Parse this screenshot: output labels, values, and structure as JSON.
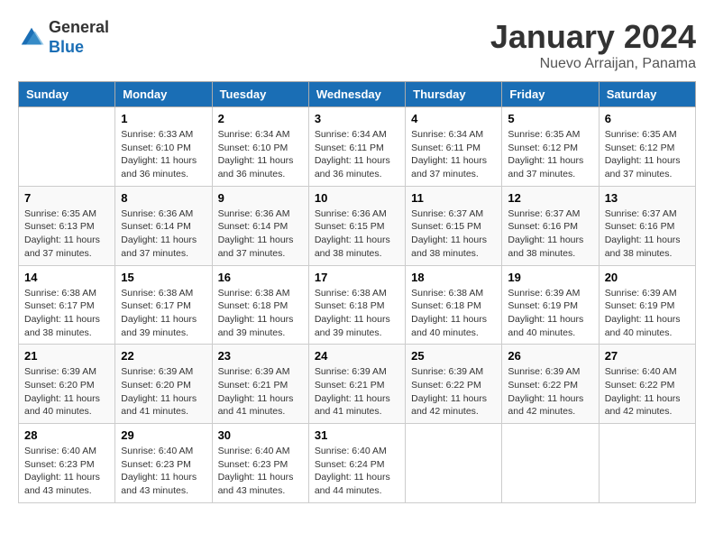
{
  "header": {
    "logo_general": "General",
    "logo_blue": "Blue",
    "month_title": "January 2024",
    "location": "Nuevo Arraijan, Panama"
  },
  "days_of_week": [
    "Sunday",
    "Monday",
    "Tuesday",
    "Wednesday",
    "Thursday",
    "Friday",
    "Saturday"
  ],
  "weeks": [
    [
      {
        "day": "",
        "sunrise": "",
        "sunset": "",
        "daylight": ""
      },
      {
        "day": "1",
        "sunrise": "Sunrise: 6:33 AM",
        "sunset": "Sunset: 6:10 PM",
        "daylight": "Daylight: 11 hours and 36 minutes."
      },
      {
        "day": "2",
        "sunrise": "Sunrise: 6:34 AM",
        "sunset": "Sunset: 6:10 PM",
        "daylight": "Daylight: 11 hours and 36 minutes."
      },
      {
        "day": "3",
        "sunrise": "Sunrise: 6:34 AM",
        "sunset": "Sunset: 6:11 PM",
        "daylight": "Daylight: 11 hours and 36 minutes."
      },
      {
        "day": "4",
        "sunrise": "Sunrise: 6:34 AM",
        "sunset": "Sunset: 6:11 PM",
        "daylight": "Daylight: 11 hours and 37 minutes."
      },
      {
        "day": "5",
        "sunrise": "Sunrise: 6:35 AM",
        "sunset": "Sunset: 6:12 PM",
        "daylight": "Daylight: 11 hours and 37 minutes."
      },
      {
        "day": "6",
        "sunrise": "Sunrise: 6:35 AM",
        "sunset": "Sunset: 6:12 PM",
        "daylight": "Daylight: 11 hours and 37 minutes."
      }
    ],
    [
      {
        "day": "7",
        "sunrise": "Sunrise: 6:35 AM",
        "sunset": "Sunset: 6:13 PM",
        "daylight": "Daylight: 11 hours and 37 minutes."
      },
      {
        "day": "8",
        "sunrise": "Sunrise: 6:36 AM",
        "sunset": "Sunset: 6:14 PM",
        "daylight": "Daylight: 11 hours and 37 minutes."
      },
      {
        "day": "9",
        "sunrise": "Sunrise: 6:36 AM",
        "sunset": "Sunset: 6:14 PM",
        "daylight": "Daylight: 11 hours and 37 minutes."
      },
      {
        "day": "10",
        "sunrise": "Sunrise: 6:36 AM",
        "sunset": "Sunset: 6:15 PM",
        "daylight": "Daylight: 11 hours and 38 minutes."
      },
      {
        "day": "11",
        "sunrise": "Sunrise: 6:37 AM",
        "sunset": "Sunset: 6:15 PM",
        "daylight": "Daylight: 11 hours and 38 minutes."
      },
      {
        "day": "12",
        "sunrise": "Sunrise: 6:37 AM",
        "sunset": "Sunset: 6:16 PM",
        "daylight": "Daylight: 11 hours and 38 minutes."
      },
      {
        "day": "13",
        "sunrise": "Sunrise: 6:37 AM",
        "sunset": "Sunset: 6:16 PM",
        "daylight": "Daylight: 11 hours and 38 minutes."
      }
    ],
    [
      {
        "day": "14",
        "sunrise": "Sunrise: 6:38 AM",
        "sunset": "Sunset: 6:17 PM",
        "daylight": "Daylight: 11 hours and 38 minutes."
      },
      {
        "day": "15",
        "sunrise": "Sunrise: 6:38 AM",
        "sunset": "Sunset: 6:17 PM",
        "daylight": "Daylight: 11 hours and 39 minutes."
      },
      {
        "day": "16",
        "sunrise": "Sunrise: 6:38 AM",
        "sunset": "Sunset: 6:18 PM",
        "daylight": "Daylight: 11 hours and 39 minutes."
      },
      {
        "day": "17",
        "sunrise": "Sunrise: 6:38 AM",
        "sunset": "Sunset: 6:18 PM",
        "daylight": "Daylight: 11 hours and 39 minutes."
      },
      {
        "day": "18",
        "sunrise": "Sunrise: 6:38 AM",
        "sunset": "Sunset: 6:18 PM",
        "daylight": "Daylight: 11 hours and 40 minutes."
      },
      {
        "day": "19",
        "sunrise": "Sunrise: 6:39 AM",
        "sunset": "Sunset: 6:19 PM",
        "daylight": "Daylight: 11 hours and 40 minutes."
      },
      {
        "day": "20",
        "sunrise": "Sunrise: 6:39 AM",
        "sunset": "Sunset: 6:19 PM",
        "daylight": "Daylight: 11 hours and 40 minutes."
      }
    ],
    [
      {
        "day": "21",
        "sunrise": "Sunrise: 6:39 AM",
        "sunset": "Sunset: 6:20 PM",
        "daylight": "Daylight: 11 hours and 40 minutes."
      },
      {
        "day": "22",
        "sunrise": "Sunrise: 6:39 AM",
        "sunset": "Sunset: 6:20 PM",
        "daylight": "Daylight: 11 hours and 41 minutes."
      },
      {
        "day": "23",
        "sunrise": "Sunrise: 6:39 AM",
        "sunset": "Sunset: 6:21 PM",
        "daylight": "Daylight: 11 hours and 41 minutes."
      },
      {
        "day": "24",
        "sunrise": "Sunrise: 6:39 AM",
        "sunset": "Sunset: 6:21 PM",
        "daylight": "Daylight: 11 hours and 41 minutes."
      },
      {
        "day": "25",
        "sunrise": "Sunrise: 6:39 AM",
        "sunset": "Sunset: 6:22 PM",
        "daylight": "Daylight: 11 hours and 42 minutes."
      },
      {
        "day": "26",
        "sunrise": "Sunrise: 6:39 AM",
        "sunset": "Sunset: 6:22 PM",
        "daylight": "Daylight: 11 hours and 42 minutes."
      },
      {
        "day": "27",
        "sunrise": "Sunrise: 6:40 AM",
        "sunset": "Sunset: 6:22 PM",
        "daylight": "Daylight: 11 hours and 42 minutes."
      }
    ],
    [
      {
        "day": "28",
        "sunrise": "Sunrise: 6:40 AM",
        "sunset": "Sunset: 6:23 PM",
        "daylight": "Daylight: 11 hours and 43 minutes."
      },
      {
        "day": "29",
        "sunrise": "Sunrise: 6:40 AM",
        "sunset": "Sunset: 6:23 PM",
        "daylight": "Daylight: 11 hours and 43 minutes."
      },
      {
        "day": "30",
        "sunrise": "Sunrise: 6:40 AM",
        "sunset": "Sunset: 6:23 PM",
        "daylight": "Daylight: 11 hours and 43 minutes."
      },
      {
        "day": "31",
        "sunrise": "Sunrise: 6:40 AM",
        "sunset": "Sunset: 6:24 PM",
        "daylight": "Daylight: 11 hours and 44 minutes."
      },
      {
        "day": "",
        "sunrise": "",
        "sunset": "",
        "daylight": ""
      },
      {
        "day": "",
        "sunrise": "",
        "sunset": "",
        "daylight": ""
      },
      {
        "day": "",
        "sunrise": "",
        "sunset": "",
        "daylight": ""
      }
    ]
  ]
}
